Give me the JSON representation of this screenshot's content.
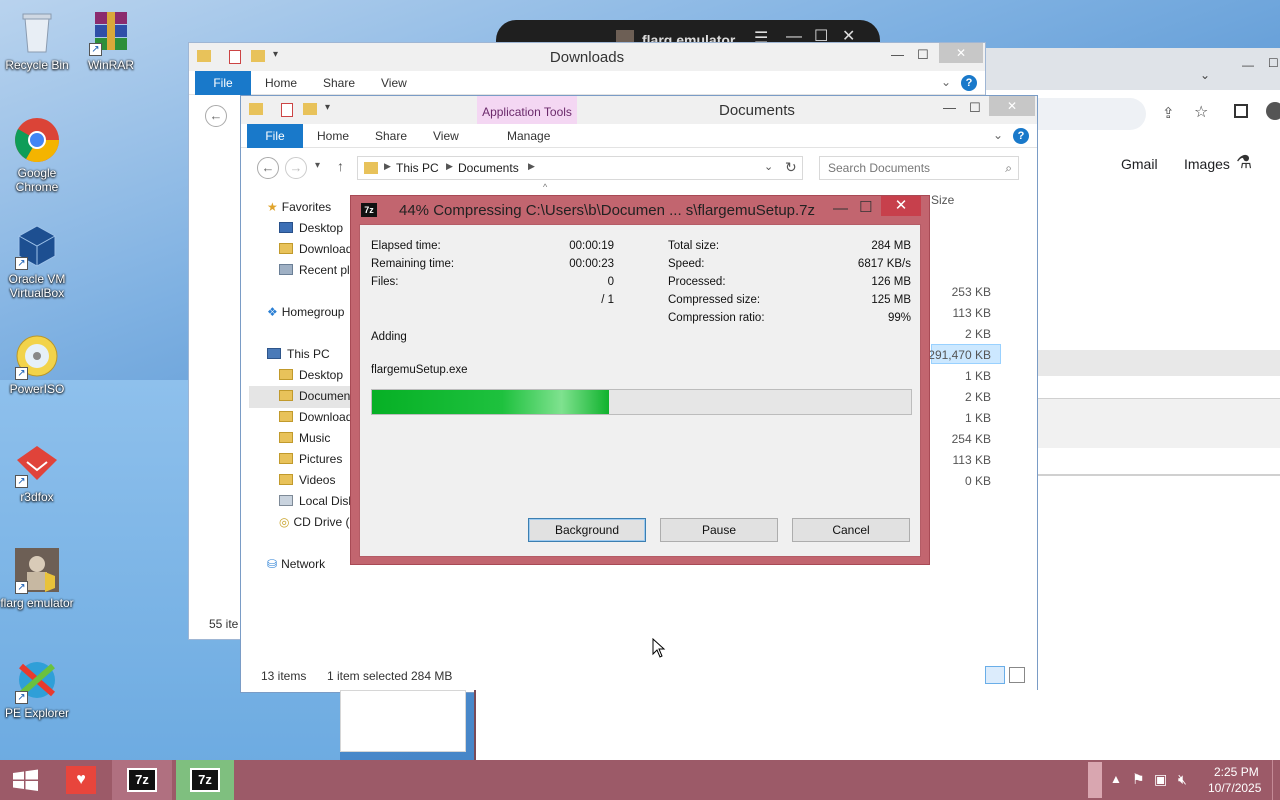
{
  "desktop": {
    "icons": [
      {
        "label": "Recycle Bin",
        "icon": "recycle-bin-icon"
      },
      {
        "label": "WinRAR",
        "icon": "winrar-icon"
      },
      {
        "label": "Google Chrome",
        "icon": "chrome-icon"
      },
      {
        "label": "Oracle VM VirtualBox",
        "icon": "virtualbox-icon"
      },
      {
        "label": "PowerISO",
        "icon": "poweriso-icon"
      },
      {
        "label": "r3dfox",
        "icon": "r3dfox-icon"
      },
      {
        "label": "flarg emulator",
        "icon": "flarg-emulator-icon"
      },
      {
        "label": "PE Explorer",
        "icon": "pe-explorer-icon"
      }
    ]
  },
  "background_app": {
    "title": "flarg emulator"
  },
  "browser": {
    "links": [
      "Gmail",
      "Images"
    ]
  },
  "downloads_window": {
    "title": "Downloads",
    "tabs": [
      "File",
      "Home",
      "Share",
      "View"
    ],
    "status": "55 ite"
  },
  "documents_window": {
    "title": "Documents",
    "context_tab_group": "Application Tools",
    "tabs": [
      "File",
      "Home",
      "Share",
      "View",
      "Manage"
    ],
    "breadcrumb": [
      "This PC",
      "Documents"
    ],
    "search_placeholder": "Search Documents",
    "column_header": "Size",
    "nav": {
      "favorites": "Favorites",
      "favorites_items": [
        "Desktop",
        "Download",
        "Recent pla"
      ],
      "homegroup": "Homegroup",
      "this_pc": "This PC",
      "this_pc_items": [
        "Desktop",
        "Documen",
        "Download",
        "Music",
        "Pictures",
        "Videos",
        "Local Disk",
        "CD Drive ("
      ],
      "network": "Network"
    },
    "sizes": [
      "253 KB",
      "113 KB",
      "2 KB",
      "291,470 KB",
      "1 KB",
      "2 KB",
      "1 KB",
      "254 KB",
      "113 KB",
      "0 KB"
    ],
    "status": {
      "items": "13 items",
      "selected": "1 item selected",
      "selected_size": "284 MB"
    }
  },
  "zip_dialog": {
    "title": "44% Compressing C:\\Users\\b\\Documen ... s\\flargemuSetup.7z",
    "progress_percent": 44,
    "stats_left": [
      {
        "label": "Elapsed time:",
        "value": "00:00:19"
      },
      {
        "label": "Remaining time:",
        "value": "00:00:23"
      },
      {
        "label": "Files:",
        "value": "0"
      },
      {
        "label": "",
        "value": "/ 1"
      }
    ],
    "stats_right": [
      {
        "label": "Total size:",
        "value": "284 MB"
      },
      {
        "label": "Speed:",
        "value": "6817 KB/s"
      },
      {
        "label": "Processed:",
        "value": "126 MB"
      },
      {
        "label": "Compressed size:",
        "value": "125 MB"
      },
      {
        "label": "Compression ratio:",
        "value": "99%"
      }
    ],
    "action": "Adding",
    "current_file": "flargemuSetup.exe",
    "buttons": {
      "background": "Background",
      "pause": "Pause",
      "cancel": "Cancel"
    }
  },
  "taskbar": {
    "clock_time": "2:25 PM",
    "clock_date": "10/7/2025",
    "apps": [
      "start-icon",
      "heart-app-icon",
      "7zip-icon",
      "7zip-icon"
    ]
  },
  "colors": {
    "accent": "#1979ca",
    "taskbar": "#9c5a68",
    "dialog_frame": "#c2656f",
    "progress": "#06b025"
  }
}
